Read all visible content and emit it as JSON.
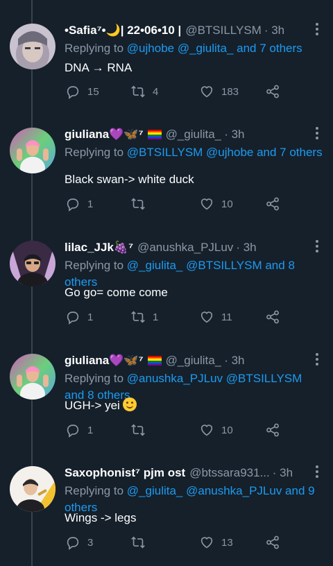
{
  "tweets": [
    {
      "name": "•Safia⁷•🌙| 22•06•10 |",
      "handle": "@BTSILLYSM",
      "time": "· 3h",
      "replying_prefix": "Replying to",
      "replying_links": "@ujhobe @_giulita_ and 7 others",
      "text": "DNA → RNA",
      "replies": "15",
      "retweets": "4",
      "likes": "183"
    },
    {
      "name": "giuliana💜🦋⁷",
      "handle": "@_giulita_",
      "time": "· 3h",
      "replying_prefix": "Replying to",
      "replying_links": "@BTSILLYSM @ujhobe and 7 others",
      "text": "Black swan-> white duck",
      "replies": "1",
      "retweets": "",
      "likes": "10"
    },
    {
      "name": "lilac_JJk🍇⁷",
      "handle": "@anushka_PJLuv",
      "time": "· 3h",
      "replying_prefix": "Replying to",
      "replying_links": "@_giulita_ @BTSILLYSM and 8 others",
      "text": "Go go= come come",
      "replies": "1",
      "retweets": "1",
      "likes": "11"
    },
    {
      "name": "giuliana💜🦋⁷",
      "handle": "@_giulita_",
      "time": "· 3h",
      "replying_prefix": "Replying to",
      "replying_links": "@anushka_PJLuv @BTSILLYSM and 8 others",
      "text": "UGH-> yei",
      "replies": "1",
      "retweets": "",
      "likes": "10"
    },
    {
      "name": "Saxophonist⁷ pjm ost",
      "handle": "@btssara931...",
      "time": "· 3h",
      "replying_prefix": "Replying to",
      "replying_links": "@_giulita_ @anushka_PJLuv and 9 others",
      "text": "Wings -> legs",
      "replies": "3",
      "retweets": "",
      "likes": "13"
    }
  ],
  "icons": {
    "reply": "reply-icon",
    "retweet": "retweet-icon",
    "like": "heart-icon",
    "share": "share-icon",
    "more": "more-icon"
  },
  "colors": {
    "background": "#15202b",
    "link": "#1d9bf0",
    "muted": "#8b98a5"
  }
}
